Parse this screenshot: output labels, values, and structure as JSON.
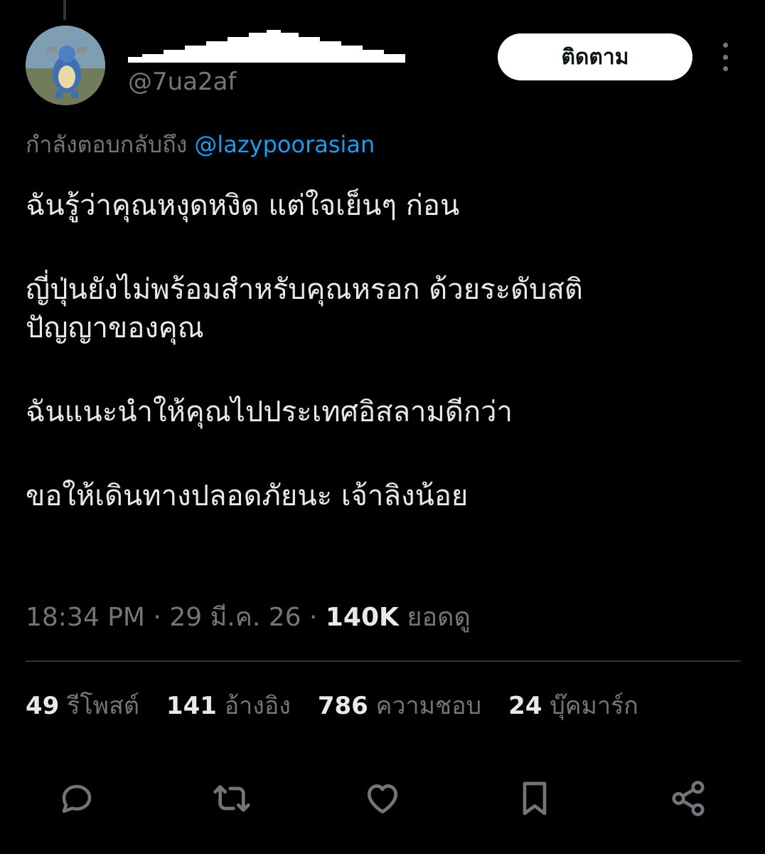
{
  "tweet": {
    "handle": "@7ua2af",
    "follow_label": "ติดตาม",
    "reply_prefix": "กำลังตอบกลับถึง ",
    "reply_mention": "@lazypoorasian",
    "lines": [
      "ฉันรู้ว่าคุณหงุดหงิด แต่ใจเย็นๆ ก่อน",
      "ญี่ปุ่นยังไม่พร้อมสำหรับคุณหรอก ด้วยระดับสติ",
      "ปัญญาของคุณ",
      "ฉันแนะนำให้คุณไปประเทศอิสลามดีกว่า",
      "ขอให้เดินทางปลอดภัยนะ เจ้าลิงน้อย"
    ],
    "time": "18:34 PM",
    "date": "29 มี.ค. 26",
    "views": "140K",
    "views_label": "ยอดดู"
  },
  "stats": {
    "reposts": "49",
    "reposts_label": "รีโพสต์",
    "quotes": "141",
    "quotes_label": "อ้างอิง",
    "likes": "786",
    "likes_label": "ความชอบ",
    "bookmarks": "24",
    "bookmarks_label": "บุ๊คมาร์ก"
  },
  "icons": {
    "reply": "reply-icon",
    "repost": "repost-icon",
    "like": "heart-icon",
    "bookmark": "bookmark-icon",
    "share": "share-icon",
    "more": "more-icon"
  },
  "colors": {
    "background": "#000000",
    "text": "#e7e9ea",
    "muted": "#71767b",
    "link": "#1d9bf0",
    "divider": "#2f3336",
    "follow_bg": "#ffffff"
  }
}
